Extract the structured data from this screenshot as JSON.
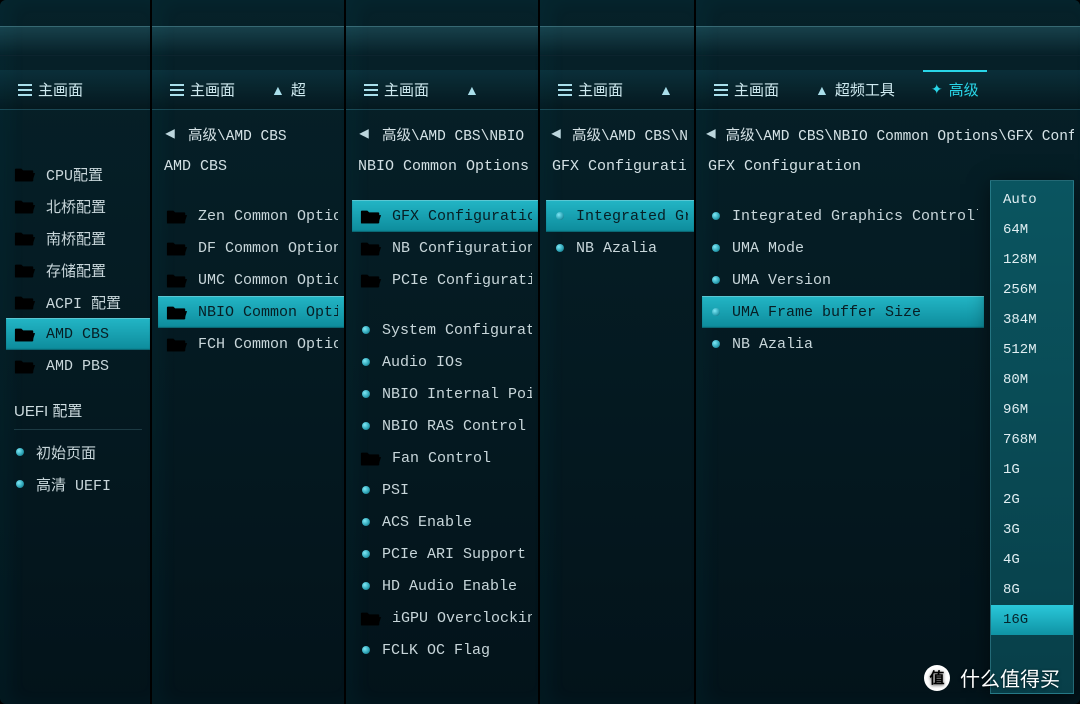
{
  "tab_main": "主画面",
  "tab_oc": "超",
  "tab_oc_full": "超频工具",
  "tab_adv": "高级",
  "p1": {
    "items": [
      {
        "label": "CPU配置"
      },
      {
        "label": "北桥配置"
      },
      {
        "label": "南桥配置"
      },
      {
        "label": "存储配置"
      },
      {
        "label": "ACPI 配置"
      },
      {
        "label": "AMD CBS",
        "sel": true
      },
      {
        "label": "AMD PBS"
      }
    ],
    "group": "UEFI 配置",
    "extra": [
      {
        "label": "初始页面"
      },
      {
        "label": "高清 UEFI"
      }
    ]
  },
  "p2": {
    "breadcrumb": "高级\\AMD CBS",
    "title": "AMD CBS",
    "items": [
      {
        "label": "Zen Common Options"
      },
      {
        "label": "DF Common Options"
      },
      {
        "label": "UMC Common Options"
      },
      {
        "label": "NBIO Common Options",
        "sel": true,
        "teal": true
      },
      {
        "label": "FCH Common Options"
      }
    ]
  },
  "p3": {
    "breadcrumb": "高级\\AMD CBS\\NBIO",
    "title": "NBIO Common Options",
    "top": [
      {
        "label": "GFX Configuration",
        "sel": true,
        "teal": true
      },
      {
        "label": "NB Configuration"
      },
      {
        "label": "PCIe Configuration"
      }
    ],
    "rest": [
      {
        "label": "System Configuration"
      },
      {
        "label": "Audio IOs"
      },
      {
        "label": "NBIO Internal Poison"
      },
      {
        "label": "NBIO RAS Control"
      },
      {
        "label": "Fan Control",
        "folder": true,
        "teal": true
      },
      {
        "label": "PSI"
      },
      {
        "label": "ACS Enable"
      },
      {
        "label": "PCIe ARI Support"
      },
      {
        "label": "HD Audio Enable"
      },
      {
        "label": "iGPU Overclocking",
        "folder": true,
        "teal": true
      },
      {
        "label": "FCLK OC Flag"
      }
    ]
  },
  "p4": {
    "breadcrumb": "高级\\AMD CBS\\N",
    "title": "GFX Configuration",
    "items": [
      {
        "label": "Integrated Graphi",
        "sel": true
      },
      {
        "label": "NB Azalia"
      }
    ]
  },
  "p5": {
    "breadcrumb": "高级\\AMD CBS\\NBIO Common Options\\GFX Config",
    "title": "GFX Configuration",
    "items": [
      {
        "label": "Integrated Graphics Controller"
      },
      {
        "label": "UMA Mode"
      },
      {
        "label": "UMA Version"
      },
      {
        "label": "UMA Frame buffer Size",
        "sel": true
      },
      {
        "label": "NB Azalia"
      }
    ],
    "dropdown": [
      "Auto",
      "64M",
      "128M",
      "256M",
      "384M",
      "512M",
      "80M",
      "96M",
      "768M",
      "1G",
      "2G",
      "3G",
      "4G",
      "8G",
      "16G"
    ],
    "dd_sel": "16G"
  },
  "watermark": "什么值得买",
  "watermark_badge": "值"
}
